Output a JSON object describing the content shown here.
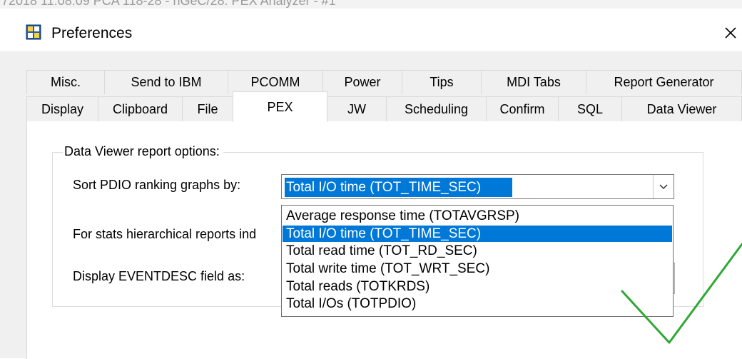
{
  "background_window": {
    "title_fragment": "72018 11:08:09 PCA 118-28 - nGeC/28: PEX Analyzer - #1"
  },
  "dialog": {
    "title": "Preferences",
    "close_glyph": "✕",
    "icon": "preferences-app-icon"
  },
  "tabs": {
    "row1": [
      "Misc.",
      "Send to IBM",
      "PCOMM",
      "Power",
      "Tips",
      "MDI Tabs",
      "Report Generator"
    ],
    "row2": [
      "Display",
      "Clipboard",
      "File",
      "PEX",
      "JW",
      "Scheduling",
      "Confirm",
      "SQL",
      "Data Viewer"
    ],
    "active": "PEX"
  },
  "group": {
    "title": "Data Viewer report options:",
    "sort_label": "Sort PDIO ranking graphs by:",
    "stats_label": "For stats hierarchical reports ind",
    "eventdesc_label": "Display EVENTDESC field as:"
  },
  "sort_combo": {
    "selected": "Total I/O time (TOT_TIME_SEC)",
    "arrow_icon": "chevron-down-icon",
    "options": [
      "Average response time (TOTAVGRSP)",
      "Total I/O time (TOT_TIME_SEC)",
      "Total read time (TOT_RD_SEC)",
      "Total write time (TOT_WRT_SEC)",
      "Total reads (TOTKRDS)",
      "Total I/Os (TOTPDIO)"
    ],
    "highlighted_index": 1
  },
  "annotation": {
    "checkmark_color": "#2fa834"
  },
  "colors": {
    "selection": "#0078d7",
    "dialog_bg": "#f0f0f0"
  }
}
